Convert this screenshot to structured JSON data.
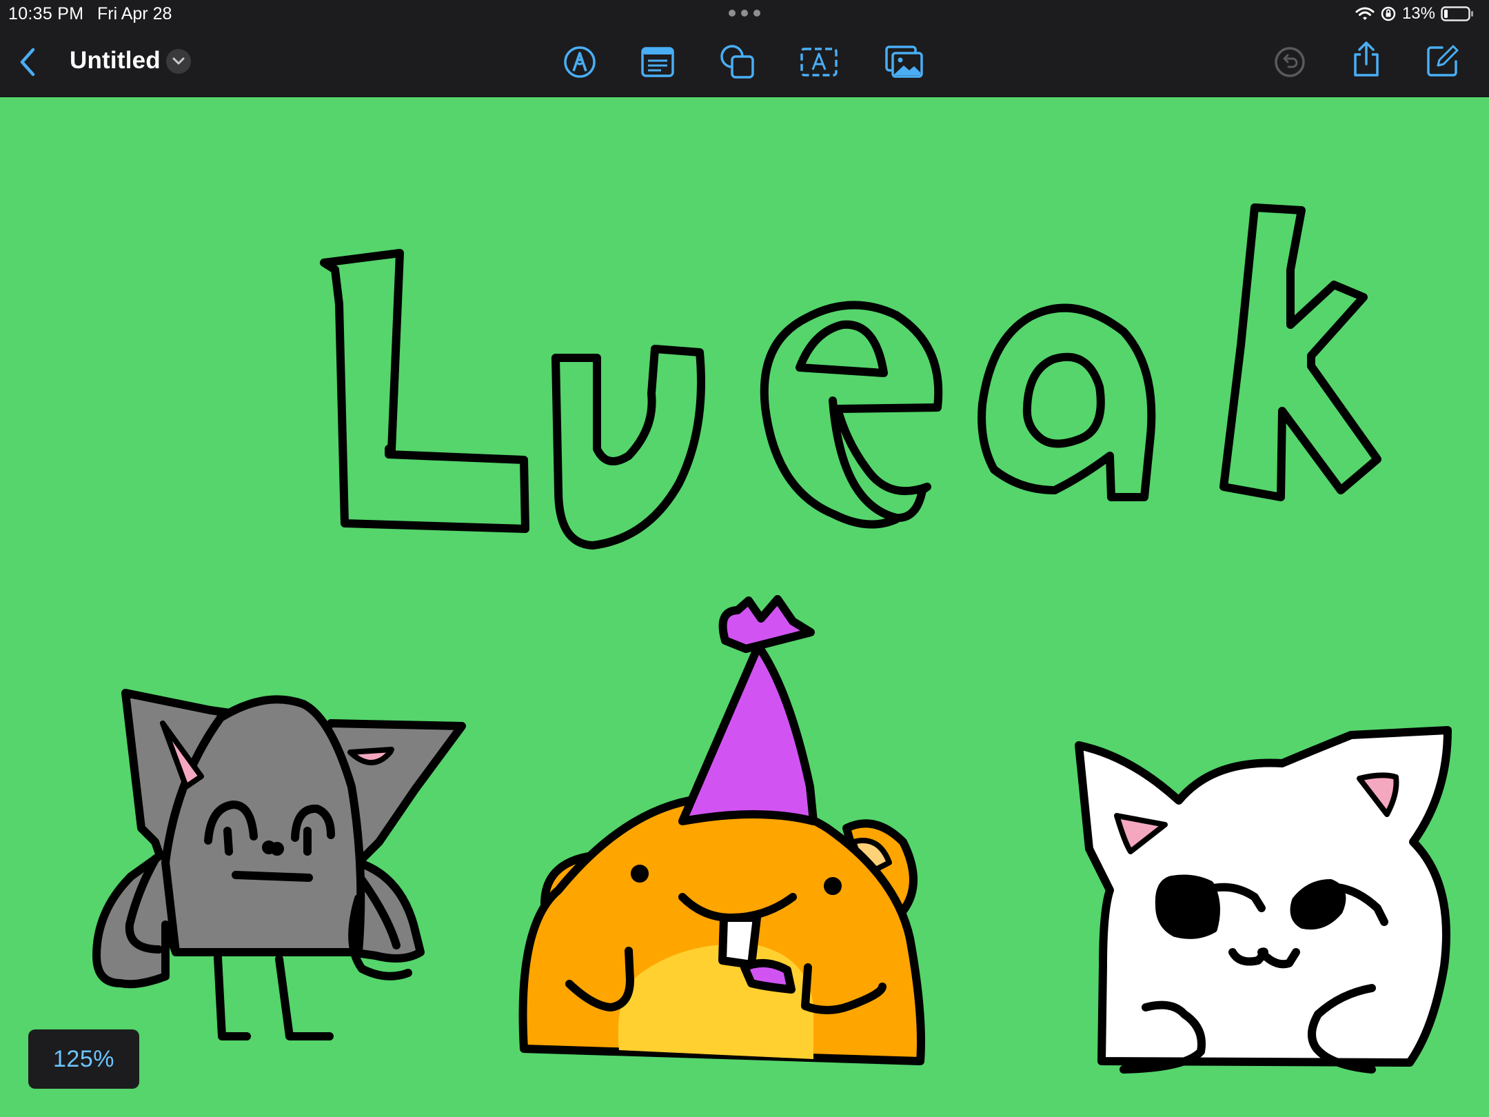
{
  "status_bar": {
    "time": "10:35 PM",
    "date": "Fri Apr 28",
    "battery_percent": "13%",
    "icons": [
      "wifi-icon",
      "orientation-lock-icon",
      "battery-icon"
    ]
  },
  "toolbar": {
    "document_title": "Untitled",
    "left_icons": [
      "back-chevron-icon",
      "title-menu-chevron-icon"
    ],
    "center_tools": [
      "pen-tool-icon",
      "sticky-note-icon",
      "shapes-icon",
      "text-box-icon",
      "media-icon"
    ],
    "right_tools": [
      "undo-icon",
      "share-icon",
      "new-board-icon"
    ],
    "accent_color": "#4aaef5",
    "disabled_color": "#5a5a5e"
  },
  "canvas": {
    "background_color": "#55d56b",
    "drawing_text": "Lueak",
    "characters": [
      "gray-bat-creature",
      "orange-hamster-with-party-hat",
      "white-cat-creature"
    ]
  },
  "zoom": {
    "level": "125%"
  }
}
